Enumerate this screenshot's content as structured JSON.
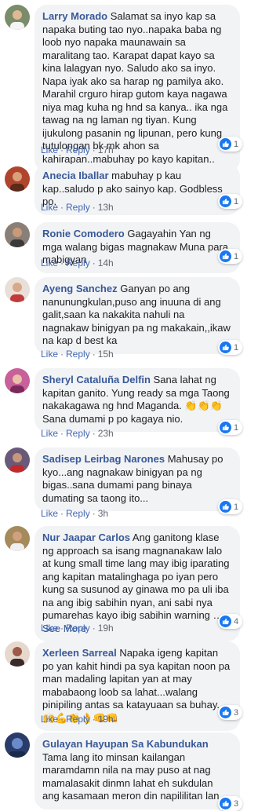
{
  "comments": [
    {
      "author": "Larry Morado",
      "text": "Salamat sa inyo kap sa napaka buting tao nyo..napaka baba ng loob nyo napaka maunawain sa maralitang tao. Karapat dapat kayo sa kina lalagyan nyo. Saludo ako sa inyo. Napa iyak ako sa harap ng pamilya ako. Marahil crguro hirap gutom kaya nagawa niya mag kuha ng hnd sa kanya.. ika nga tawag na ng laman ng tiyan. Kung ijukulong pasanin ng lipunan, pero kung tutulongan bk mk ahon sa kahirapan..mabuhay po kayo kapitan..",
      "see_more": "",
      "like": "Like",
      "reply": "Reply",
      "time": "17h",
      "reactions": "1",
      "avatar_color": "#7a8c6a"
    },
    {
      "author": "Anecia Iballar",
      "text": "mabuhay p kau kap..saludo p ako sainyo kap. Godbless po.",
      "see_more": "",
      "like": "Like",
      "reply": "Reply",
      "time": "13h",
      "reactions": "1",
      "avatar_color": "#b0452e"
    },
    {
      "author": "Ronie Comodero",
      "text": "Gagayahin Yan ng mga walang bigas magnakaw Muna para mabigyan",
      "see_more": "",
      "like": "Like",
      "reply": "Reply",
      "time": "14h",
      "reactions": "1",
      "avatar_color": "#8a7f76"
    },
    {
      "author": "Ayeng Sanchez",
      "text": "Ganyan po ang nanunungkulan,puso ang inuuna di ang galit,saan ka nakakita nahuli na nagnakaw binigyan pa ng makakain,,ikaw na kap d best ka",
      "see_more": "",
      "like": "Like",
      "reply": "Reply",
      "time": "15h",
      "reactions": "1",
      "avatar_color": "#c23a3a"
    },
    {
      "author": "Sheryl Cataluña Delfin",
      "text": "Sana lahat ng kapitan ganito. Yung ready sa mga Taong nakakagawa ng hnd Maganda. 👏👏👏 Sana dumami p po kagaya nio.",
      "see_more": "",
      "like": "Like",
      "reply": "Reply",
      "time": "23h",
      "reactions": "1",
      "avatar_color": "#c8609a"
    },
    {
      "author": "Sadisep Leirbag Narones",
      "text": "Mahusay po kyo...ang nagnakaw binigyan pa ng bigas..sana dumami pang binaya dumating sa taong ito...",
      "see_more": "",
      "like": "Like",
      "reply": "Reply",
      "time": "3h",
      "reactions": "1",
      "avatar_color": "#6a5a7a"
    },
    {
      "author": "Nur Jaapar Carlos",
      "text": "Ang ganitong klase ng approach sa isang magnanakaw lalo at kung small time lang may ibig iparating ang kapitan matalinghaga po iyan pero kung sa susunod ay ginawa mo pa uli iba na ang ibig sabihin nyan, ani sabi nya pumarehas kayo ibig sabihin warning …",
      "see_more": "See More",
      "like": "Like",
      "reply": "Reply",
      "time": "19h",
      "reactions": "4",
      "avatar_color": "#a58a5c"
    },
    {
      "author": "Xerleen Sarreal",
      "text": "Napaka igeng kapitan po yan kahit hindi pa sya kapitan noon pa man madaling lapitan yan at may mababaong loob sa lahat...walang pinipiling antas sa katayuaan sa buhay.. 🙌💪👏👌👊👊",
      "see_more": "",
      "like": "Like",
      "reply": "Reply",
      "time": "19h",
      "reactions": "3",
      "avatar_color": "#9c5a4a"
    },
    {
      "author": "Gulayan Hayupan Sa Kabundukan",
      "text": "Tama lang ito minsan kailangan maramdamn nila na may puso at nag mamalasakit dinmn lahat eh sukdulan ang kasamaan meron din napililitan lan",
      "see_more": "",
      "like": "Like",
      "reply": "Reply",
      "time": "",
      "reactions": "3",
      "avatar_color": "#2a3d6a"
    }
  ]
}
